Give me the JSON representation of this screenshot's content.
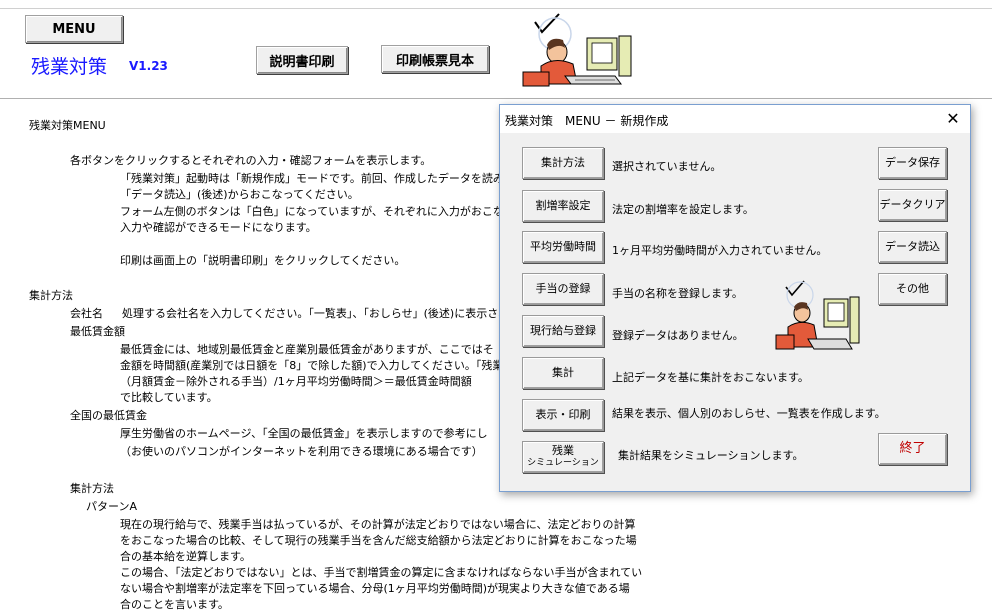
{
  "header": {
    "menu_label": "MENU",
    "app_title": "残業対策",
    "version": "V1.23",
    "print_manual_label": "説明書印刷",
    "form_sample_label": "印刷帳票見本"
  },
  "document": {
    "heading": "残業対策MENU",
    "intro": [
      "各ボタンをクリックするとそれぞれの入力・確認フォームを表示します。",
      "「残業対策」起動時は「新規作成」モードです。前回、作成したデータを読み込",
      "「データ読込」(後述)からおこなってください。",
      "フォーム左側のボタンは「白色」になっていますが、それぞれに入力がおこなわ",
      "入力や確認ができるモードになります。",
      "印刷は画面上の「説明書印刷」をクリックしてください。"
    ],
    "section_calc": "集計方法",
    "company_label": "会社名",
    "company_desc": "処理する会社名を入力してください。「一覧表」、「おしらせ」(後述)に表示され",
    "min_wage_label": "最低賃金額",
    "min_wage_lines": [
      "最低賃金には、地域別最低賃金と産業別最低賃金がありますが、ここではそ",
      "金額を時間額(産業別では日額を「8」で除した額)で入力してください。「残業",
      "（月額賃金－除外される手当）/1ヶ月平均労働時間＞＝最低賃金時間額",
      "で比較しています。"
    ],
    "national_min_label": "全国の最低賃金",
    "national_min_lines": [
      "厚生労働省のホームページ、「全国の最低賃金」を表示しますので参考にし",
      "（お使いのパソコンがインターネットを利用できる環境にある場合です）"
    ],
    "section_calc2": "集計方法",
    "pattern_label": "パターンA",
    "pattern_lines": [
      "現在の現行給与で、残業手当は払っているが、その計算が法定どおりではない場合に、法定どおりの計算",
      "をおこなった場合の比較、そして現行の残業手当を含んだ総支給額から法定どおりに計算をおこなった場",
      "合の基本給を逆算します。",
      "この場合、「法定どおりではない」とは、手当で割増賃金の算定に含まなければならない手当が含まれてい",
      "ない場合や割増率が法定率を下回っている場合、分母(1ヶ月平均労働時間)が現実より大きな値である場",
      "合のことを言います。"
    ]
  },
  "dialog": {
    "title": "残業対策　MENU － 新規作成",
    "close_label": "✕",
    "rows": [
      {
        "button": "集計方法",
        "desc": "選択されていません。"
      },
      {
        "button": "割増率設定",
        "desc": "法定の割増率を設定します。"
      },
      {
        "button": "平均労働時間",
        "desc": "1ヶ月平均労働時間が入力されていません。"
      },
      {
        "button": "手当の登録",
        "desc": "手当の名称を登録します。"
      },
      {
        "button": "現行給与登録",
        "desc": "登録データはありません。"
      },
      {
        "button": "集計",
        "desc": "上記データを基に集計をおこないます。"
      },
      {
        "button": "表示・印刷",
        "desc": "結果を表示、個人別のおしらせ、一覧表を作成します。"
      },
      {
        "button_line1": "残業",
        "button_line2": "シミュレーション",
        "desc": "集計結果をシミュレーションします。"
      }
    ],
    "right_buttons": {
      "save": "データ保存",
      "clear": "データクリア",
      "load": "データ読込",
      "other": "その他",
      "end": "終了"
    },
    "colors": {
      "end_text": "#c00000",
      "title_accent": "#1a1aff"
    }
  }
}
